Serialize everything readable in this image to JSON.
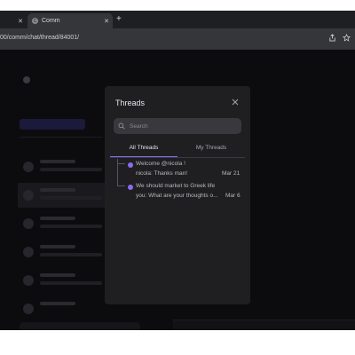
{
  "browser": {
    "tabs": [
      {
        "label": ""
      },
      {
        "label": "Comm",
        "favicon": "C"
      }
    ],
    "url": "00/comm/chat/thread/84001/"
  },
  "modal": {
    "title": "Threads",
    "search_placeholder": "Search",
    "tabs": [
      "All Threads",
      "My Threads"
    ],
    "active_tab": "All Threads",
    "threads": [
      {
        "title": "Welcome @nicola !",
        "last_message": "nicola: Thanks man!",
        "date": "Mar 21"
      },
      {
        "title": "We should market to Greek life",
        "last_message": "you: What are your thoughts o...",
        "date": "Mar 6"
      }
    ]
  },
  "colors": {
    "accent": "#8b6cf0",
    "modal_bg": "#1f1f22",
    "backdrop": "#111113"
  }
}
